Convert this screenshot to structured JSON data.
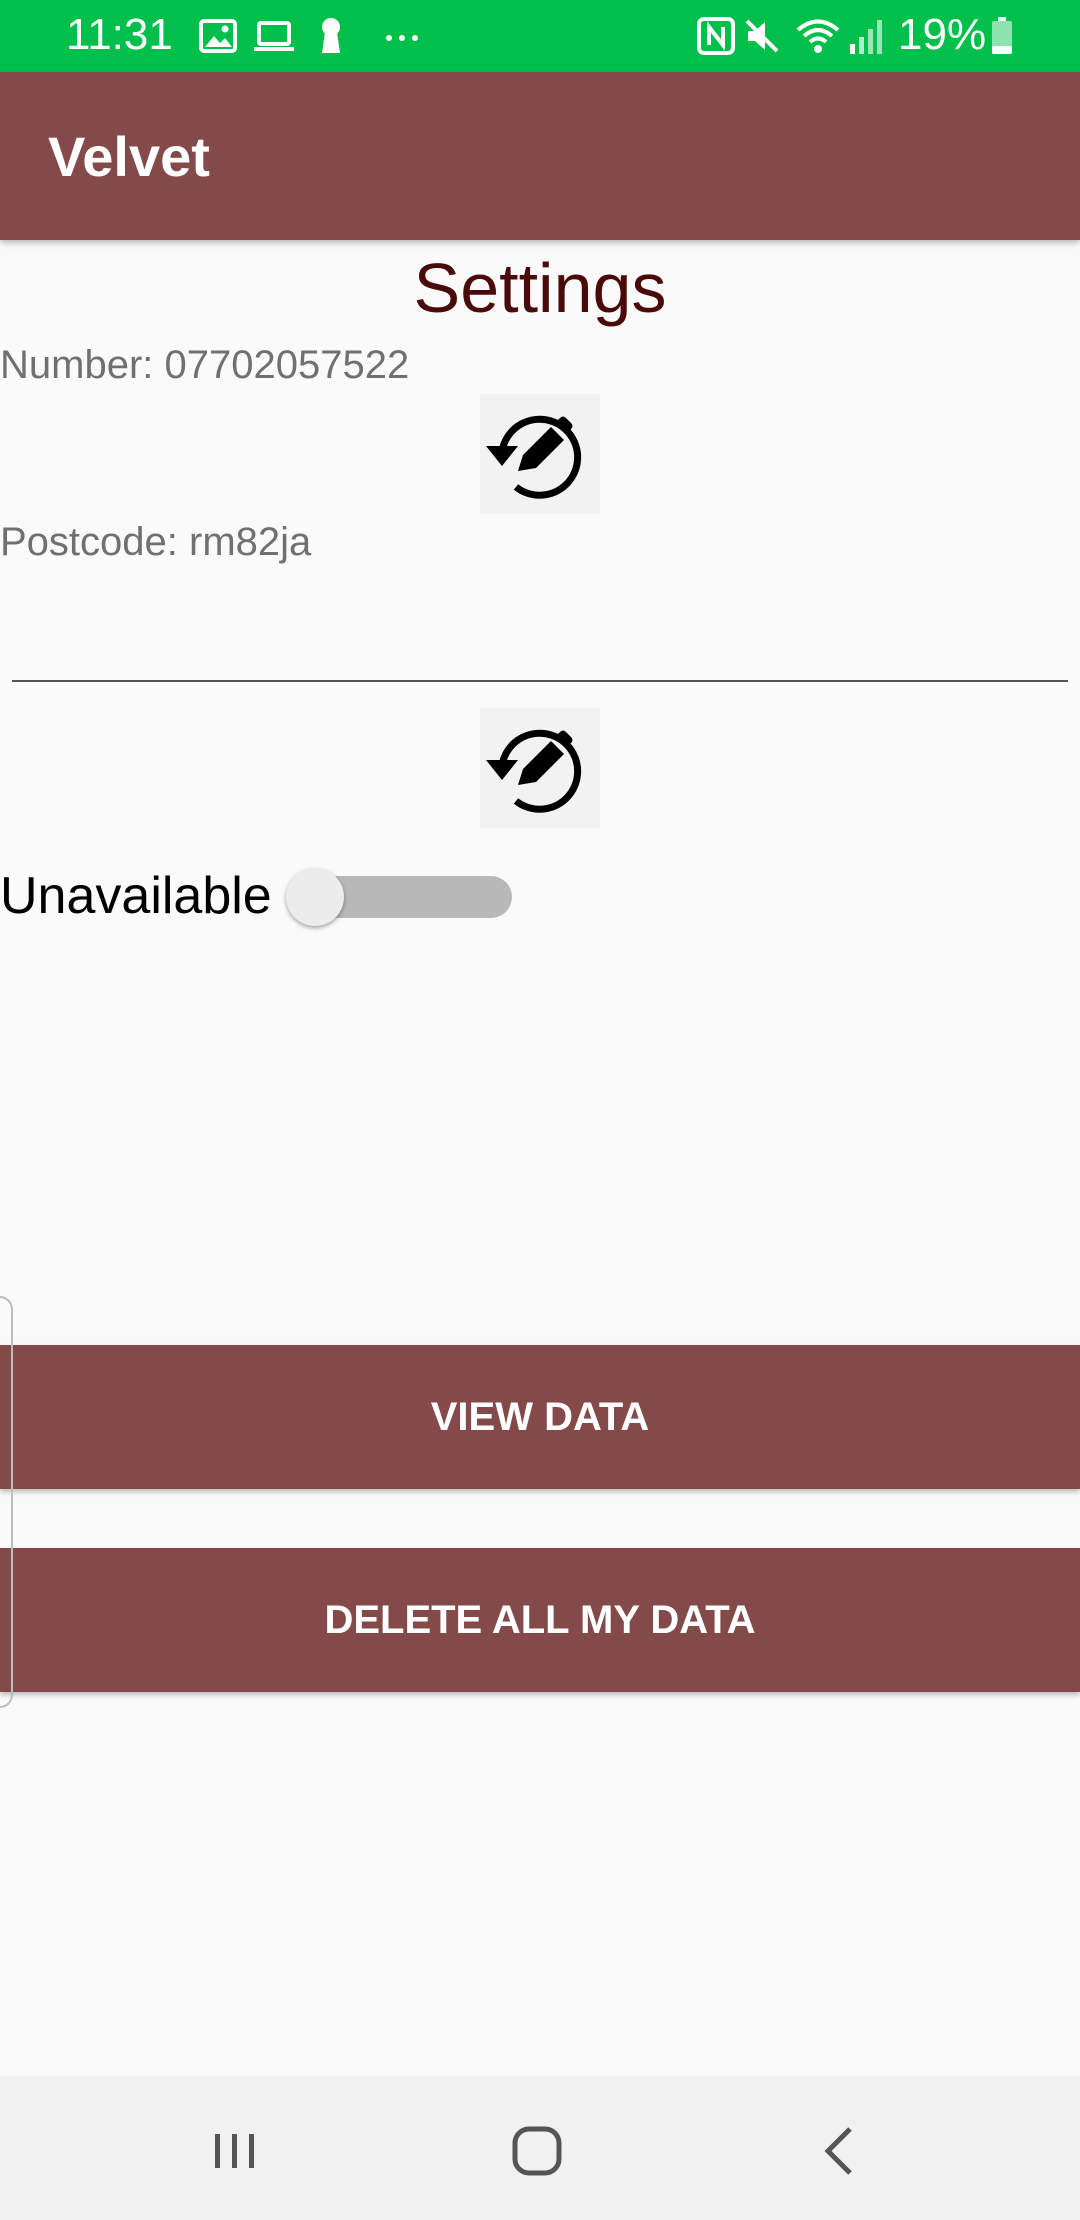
{
  "status_bar": {
    "time": "11:31",
    "battery": "19%",
    "icons": [
      "gallery-icon",
      "laptop-icon",
      "keyhole-icon",
      "more-icon",
      "nfc-icon",
      "mute-icon",
      "wifi-icon",
      "signal-icon",
      "battery-icon"
    ]
  },
  "app_bar": {
    "title": "Velvet"
  },
  "settings": {
    "title": "Settings",
    "number_text": "Number: 07702057522",
    "postcode_text": "Postcode: rm82ja",
    "postcode_input_value": "",
    "availability_label": "Unavailable",
    "availability_on": false
  },
  "buttons": {
    "view_data": "VIEW DATA",
    "delete_all": "DELETE ALL MY DATA"
  },
  "colors": {
    "status_bar": "#00c04b",
    "primary": "#844a4a",
    "title_text": "#4a0a0a",
    "background": "#fafafa"
  }
}
